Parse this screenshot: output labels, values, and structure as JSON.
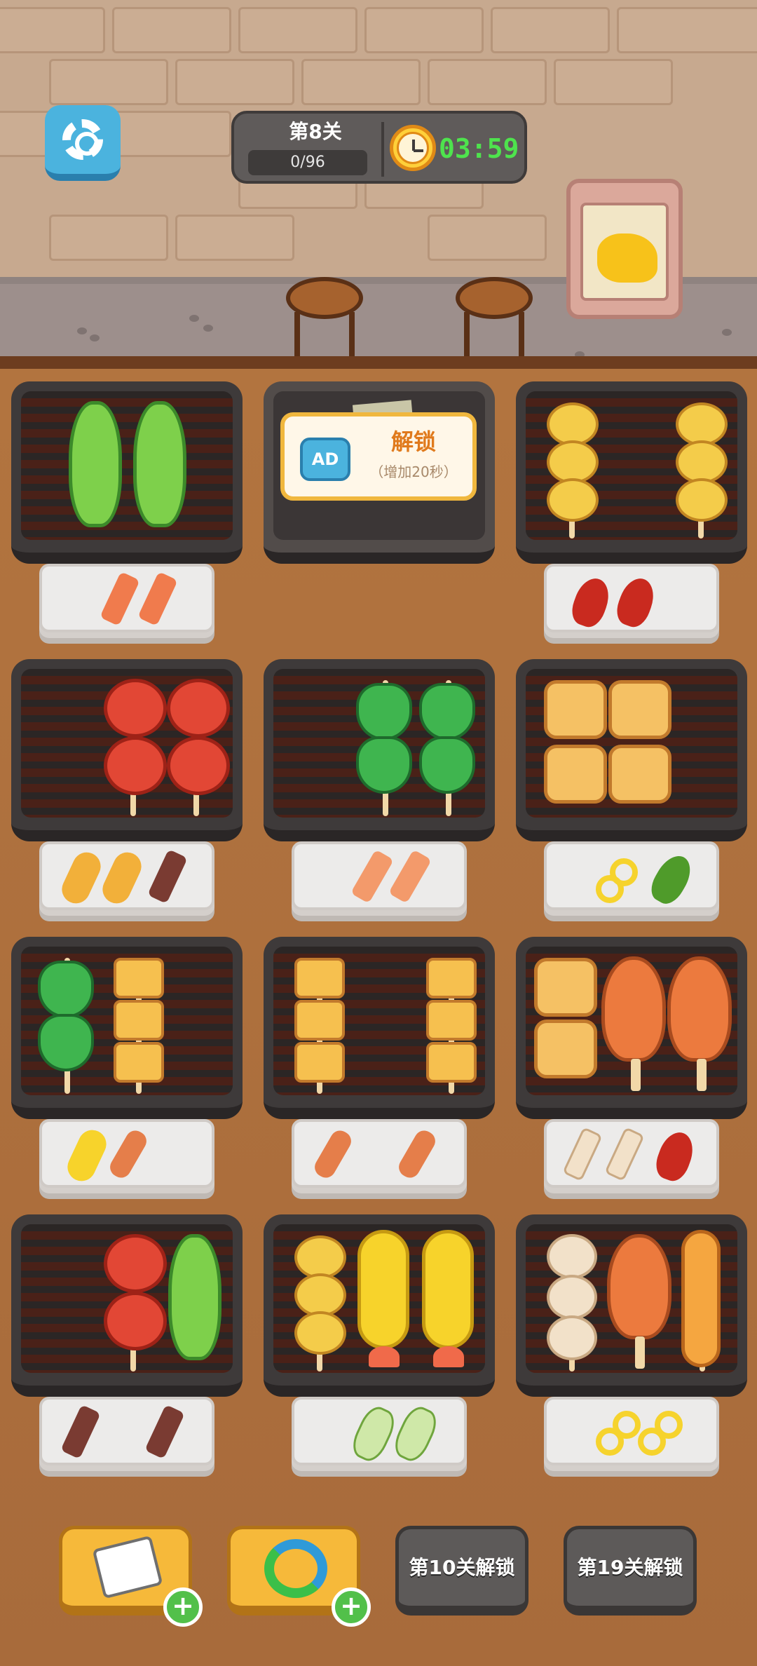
{
  "hud": {
    "level": "第8关",
    "progress": "0/96",
    "timer": "03:59"
  },
  "locked_grill": {
    "badge": "AD",
    "title": "解锁",
    "subtitle": "（增加20秒）"
  },
  "grills": [
    {
      "foods": [
        "lettuce",
        "lettuce"
      ],
      "plate": [
        "shrimp-skewer",
        "shrimp-skewer"
      ]
    },
    {
      "locked": true
    },
    {
      "foods": [
        "egg-ball-skewer",
        "egg-ball-skewer"
      ],
      "plate": [
        "chili-pepper",
        "chili-pepper"
      ]
    },
    {
      "foods": [
        "tomato-skewer",
        "tomato-skewer"
      ],
      "plate": [
        "corn-dog",
        "corn-dog",
        "meatball-skewer"
      ]
    },
    {
      "foods": [
        "bok-choy-skewer",
        "bok-choy-skewer"
      ],
      "plate": [
        "salmon-skewer",
        "salmon-skewer"
      ]
    },
    {
      "foods": [
        "toast",
        "toast"
      ],
      "plate": [
        "pineapple-ring",
        "green-pepper"
      ]
    },
    {
      "foods": [
        "bok-choy-skewer",
        "tofu-skewer"
      ],
      "plate": [
        "corn-shrimp",
        "sausage-skewer"
      ]
    },
    {
      "foods": [
        "tofu-skewer",
        "tofu-skewer"
      ],
      "plate": [
        "sausage-skewer",
        "sausage-skewer"
      ]
    },
    {
      "foods": [
        "toast",
        "drumstick",
        "drumstick"
      ],
      "plate": [
        "fishball-skewer",
        "fishball-skewer",
        "chili-pepper"
      ]
    },
    {
      "foods": [
        "tomato-skewer",
        "lettuce"
      ],
      "plate": [
        "meatball-skewer",
        "meatball-skewer"
      ]
    },
    {
      "foods": [
        "egg-ball-skewer",
        "corn-shrimp",
        "corn-shrimp"
      ],
      "plate": [
        "cabbage",
        "cabbage"
      ]
    },
    {
      "foods": [
        "fishball-skewer",
        "drumstick",
        "spiral-sausage"
      ],
      "plate": [
        "pineapple-ring",
        "pineapple-ring"
      ]
    }
  ],
  "tools": {
    "tool1_icon": "paper-plate-icon",
    "tool2_icon": "refresh-icon",
    "tool3_label": "第10关解锁",
    "tool4_label": "第19关解锁"
  },
  "colors": {
    "timer": "#4ee34d",
    "unlock_title": "#e07a1c",
    "button_yellow": "#f6b93a",
    "plus_green": "#52c04a"
  }
}
